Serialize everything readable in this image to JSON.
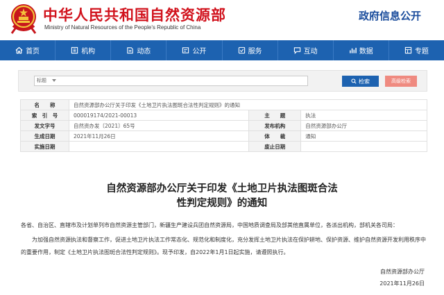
{
  "header": {
    "site_name": "中华人民共和国自然资源部",
    "site_name_en": "Ministry of Natural Resources of the People’s Republic of China",
    "section_title": "政府信息公开"
  },
  "nav": {
    "items": [
      {
        "label": "首页",
        "icon": "home-icon"
      },
      {
        "label": "机构",
        "icon": "institution-icon"
      },
      {
        "label": "动态",
        "icon": "news-icon"
      },
      {
        "label": "公开",
        "icon": "open-icon"
      },
      {
        "label": "服务",
        "icon": "service-icon"
      },
      {
        "label": "互动",
        "icon": "interaction-icon"
      },
      {
        "label": "数据",
        "icon": "data-icon"
      },
      {
        "label": "专题",
        "icon": "topic-icon"
      }
    ]
  },
  "search": {
    "field_select": "标题",
    "placeholder": "",
    "search_label": "检索",
    "advanced_label": "高级检索"
  },
  "info": {
    "name_label": "名　　称",
    "name_value": "自然资源部办公厅关于印发《土地卫片执法图斑合法性判定规则》的通知",
    "index_label": "索　引　号",
    "index_value": "000019174/2021-00013",
    "subject_label": "主　　题",
    "subject_value": "执法",
    "docno_label": "发文字号",
    "docno_value": "自然资办发〔2021〕65号",
    "issuer_label": "发布机构",
    "issuer_value": "自然资源部办公厅",
    "created_label": "生成日期",
    "created_value": "2021年11月26日",
    "carrier_label": "体　　裁",
    "carrier_value": "通知",
    "effective_label": "实施日期",
    "effective_value": "",
    "expiry_label": "废止日期",
    "expiry_value": ""
  },
  "document": {
    "title_line1": "自然资源部办公厅关于印发《土地卫片执法图斑合法",
    "title_line2": "性判定规则》的通知",
    "addressee": "各省、自治区、直辖市及计划单列市自然资源主管部门，新疆生产建设兵团自然资源局，中国地质调查局及部其他直属单位，各派出机构，部机关各司局：",
    "body": "为加强自然资源执法和督察工作，促进土地卫片执法工作常态化、规范化和制度化，充分发挥土地卫片执法在保护耕地、保护资源、维护自然资源开发利用秩序中的重要作用，制定《土地卫片执法图斑合法性判定规则》。现予印发，自2022年1月1日起实施，请遵照执行。",
    "issuer": "自然资源部办公厅",
    "date": "2021年11月26日"
  },
  "colors": {
    "brand_red": "#d1121c",
    "nav_blue": "#1d62b0",
    "header_blue": "#1a4c9c",
    "advanced_btn": "#ef8a80"
  }
}
